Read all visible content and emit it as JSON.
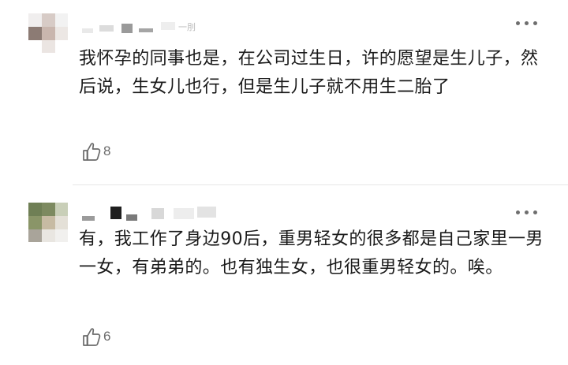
{
  "comments": [
    {
      "timestamp_fragment": "一刖",
      "text": "我怀孕的同事也是，在公司过生日，许的愿望是生儿子，然后说，生女儿也行，但是生儿子就不用生二胎了",
      "likes": "8",
      "like_icon": "thumbs-up-icon",
      "more_icon": "more-icon"
    },
    {
      "text": "有，我工作了身边90后，重男轻女的很多都是自己家里一男一女，有弟弟的。也有独生女，也很重男轻女的。唉。",
      "likes": "6",
      "like_icon": "thumbs-up-icon",
      "more_icon": "more-icon"
    }
  ],
  "colors": {
    "text": "#1a1a1a",
    "muted": "#6b6b6b",
    "divider": "#e6e6e6",
    "background": "#ffffff"
  }
}
